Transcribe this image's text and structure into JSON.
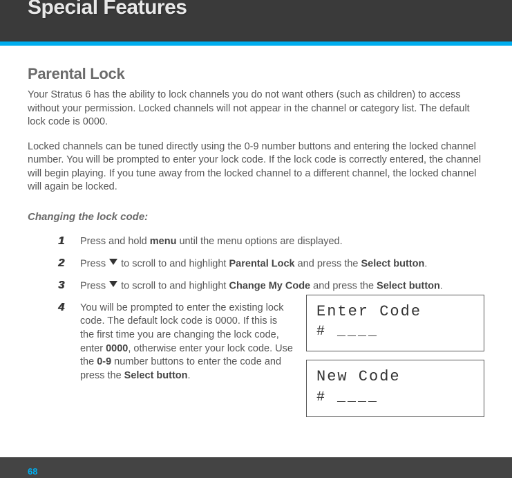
{
  "header": {
    "title": "Special Features"
  },
  "section": {
    "title": "Parental Lock",
    "para1": "Your Stratus 6 has the ability to lock channels you do not want others (such as children) to access without your permission. Locked channels will not appear in the channel or category list. The default lock code is 0000.",
    "para2": "Locked channels can be tuned directly using the 0-9 number buttons and entering the locked channel number. You will be prompted to enter your lock code. If the lock code is correctly entered, the channel will begin playing. If you tune away from the locked channel to a different channel, the locked channel will again be locked.",
    "subheading": "Changing the lock code:"
  },
  "steps": {
    "s1": {
      "num": "1",
      "t1": "Press and hold ",
      "b1": "menu",
      "t2": " until the menu options are displayed."
    },
    "s2": {
      "num": "2",
      "t1": "Press ",
      "t2": " to scroll to and highlight ",
      "b1": "Parental Lock",
      "t3": " and press the ",
      "b2": "Select button",
      "t4": "."
    },
    "s3": {
      "num": "3",
      "t1": "Press ",
      "t2": " to scroll to and highlight ",
      "b1": "Change My Code",
      "t3": " and press the ",
      "b2": "Select button",
      "t4": "."
    },
    "s4": {
      "num": "4",
      "t1": "You will be prompted to enter the existing lock code. The default lock code is 0000. If this is the first time you are changing the lock code, enter ",
      "b1": "0000",
      "t2": ", otherwise enter your lock code. Use the ",
      "b2": "0-9",
      "t3": " number buttons to enter the code and press the ",
      "b3": "Select button",
      "t4": "."
    }
  },
  "screens": {
    "enter": {
      "line1": "Enter Code",
      "line2": "# ____"
    },
    "new": {
      "line1": "New Code",
      "line2": "# ____"
    }
  },
  "page_number": "68"
}
